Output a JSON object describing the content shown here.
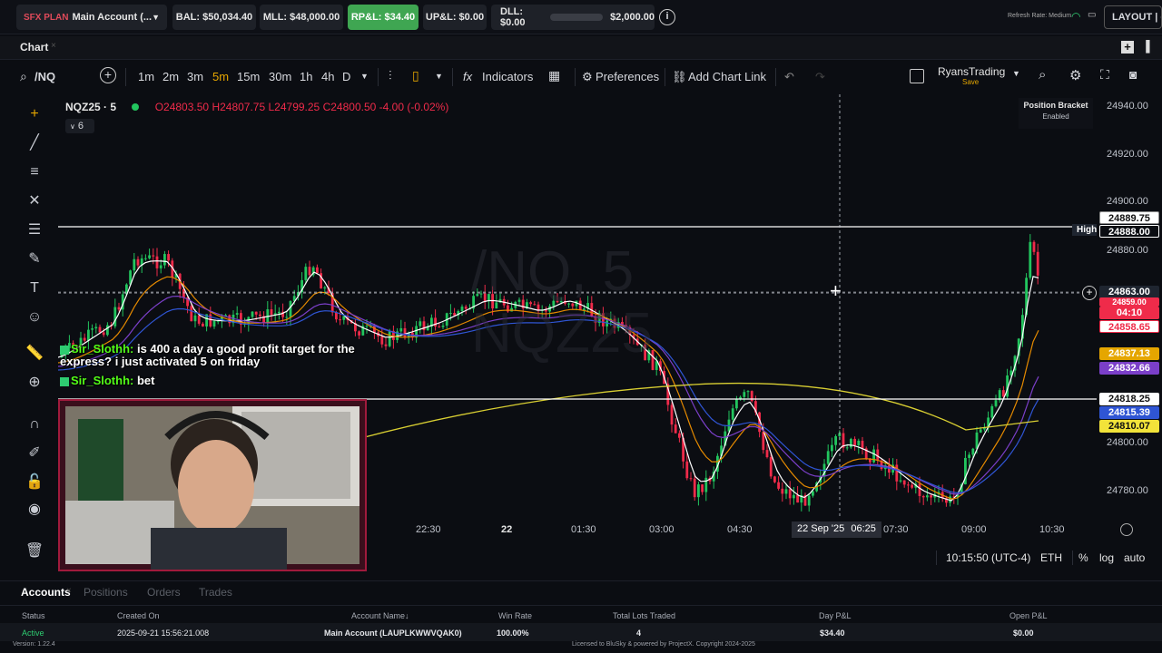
{
  "topbar": {
    "plan_account": "Main Account (...",
    "plan_prefix": "SFX PLAN",
    "bal": "BAL: $50,034.40",
    "mll": "MLL: $48,000.00",
    "rpl": "RP&L: $34.40",
    "upl": "UP&L: $0.00",
    "dll": "DLL: $0.00",
    "dll_limit": "$2,000.00",
    "refresh_rate": "Refresh Rate: Medium",
    "layout": "LAYOUT | de"
  },
  "chart_tab": {
    "label": "Chart"
  },
  "toolbar": {
    "symbol": "/NQ",
    "timeframes": [
      "1m",
      "2m",
      "3m",
      "5m",
      "15m",
      "30m",
      "1h",
      "4h",
      "D"
    ],
    "active_timeframe": "5m",
    "indicators": "Indicators",
    "preferences": "Preferences",
    "add_chart_link": "Add Chart Link",
    "profile_name": "RyansTrading",
    "profile_save": "Save"
  },
  "legend": {
    "title": "NQZ25 · 5",
    "open": "O24803.50",
    "high": "H24807.75",
    "low": "L24799.25",
    "close": "C24800.50",
    "change": "-4.00 (-0.02%)",
    "studies_count": "6"
  },
  "watermark": {
    "line1": "/NQ, 5",
    "line2": "NQZ25"
  },
  "position_bracket": {
    "title": "Position Bracket",
    "status": "Enabled"
  },
  "price_axis": {
    "ticks": [
      "24940.00",
      "24920.00",
      "24900.00",
      "24880.00",
      "24800.00",
      "24780.00"
    ],
    "labels": {
      "a": "24889.75",
      "high_tag": "High",
      "high": "24888.00",
      "last": "24863.00",
      "last_hidden": "24859.00",
      "countdown": "04:10",
      "red2": "24858.65",
      "orange": "24837.13",
      "purple": "24832.66",
      "white": "24818.25",
      "blue": "24815.39",
      "yellow": "24810.07"
    }
  },
  "time_axis": {
    "ticks": [
      "22:30",
      "22",
      "01:30",
      "03:00",
      "04:30",
      "07:30",
      "09:00",
      "10:30"
    ],
    "crosshair_label": "22 Sep '25",
    "crosshair_time": "06:25"
  },
  "status_row": {
    "clock": "10:15:50 (UTC-4)",
    "session": "ETH",
    "pct": "%",
    "log": "log",
    "auto": "auto"
  },
  "chat": [
    {
      "user": "Sir_Slothh:",
      "message": "is 400 a day a good profit target for the express? i just activated 5 on friday"
    },
    {
      "user": "Sir_Slothh:",
      "message": "bet"
    }
  ],
  "accounts_panel": {
    "tabs": [
      "Accounts",
      "Positions",
      "Orders",
      "Trades"
    ],
    "columns": [
      "Status",
      "Created On",
      "Account Name",
      "Win Rate",
      "Total Lots Traded",
      "Day P&L",
      "Open P&L"
    ],
    "row": {
      "status": "Active",
      "created_on": "2025-09-21 15:56:21.008",
      "account_name": "Main Account (LAUPLKWWVQAK0)",
      "win_rate": "100.00%",
      "lots": "4",
      "day_pnl": "$34.40",
      "open_pnl": "$0.00"
    }
  },
  "footer": {
    "version": "Version: 1.22.4",
    "license": "Licensed to BluSky & powered by ProjectX. Copyright 2024-2025"
  },
  "colors": {
    "up": "#22c55e",
    "down": "#ef2b4a",
    "rpl_bg": "#3fa652",
    "accent_orange": "#e5a600"
  }
}
